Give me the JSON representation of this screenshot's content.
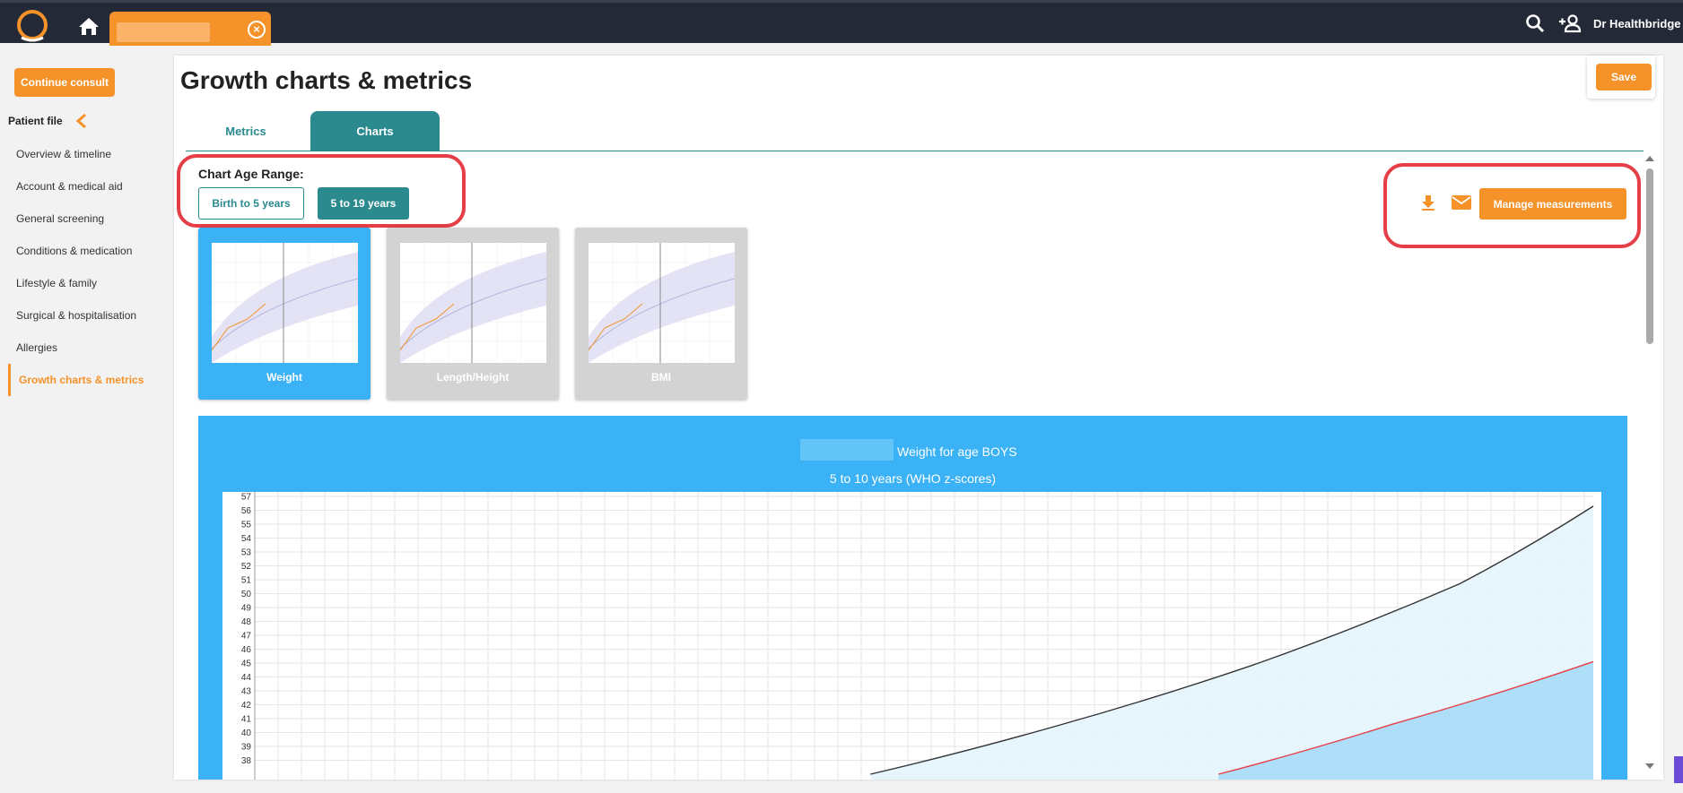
{
  "topbar": {
    "logo_icon": "ring-logo-icon",
    "home_icon": "home-icon",
    "patient_tab_close_icon": "close-circle-icon",
    "search_icon": "search-icon",
    "add_user_icon": "add-person-icon",
    "user_name": "Dr Healthbridge"
  },
  "sidebar": {
    "continue_label": "Continue consult",
    "patient_file_label": "Patient file",
    "collapse_icon": "chevron-left-icon",
    "items": [
      {
        "label": "Overview & timeline"
      },
      {
        "label": "Account & medical aid"
      },
      {
        "label": "General screening"
      },
      {
        "label": "Conditions & medication"
      },
      {
        "label": "Lifestyle & family"
      },
      {
        "label": "Surgical & hospitalisation"
      },
      {
        "label": "Allergies"
      },
      {
        "label": "Growth charts & metrics",
        "active": true
      }
    ]
  },
  "main": {
    "title": "Growth charts & metrics",
    "save_label": "Save",
    "tabs": [
      {
        "label": "Metrics",
        "active": false
      },
      {
        "label": "Charts",
        "active": true
      }
    ],
    "age_range_label": "Chart Age Range:",
    "age_ranges": [
      {
        "label": "Birth to 5 years",
        "selected": false
      },
      {
        "label": "5 to 19 years",
        "selected": true
      }
    ],
    "download_icon": "download-icon",
    "email_icon": "mail-icon",
    "manage_label": "Manage measurements",
    "chart_thumbnails": [
      {
        "label": "Weight",
        "selected": true
      },
      {
        "label": "Length/Height",
        "selected": false
      },
      {
        "label": "BMI",
        "selected": false
      }
    ],
    "chart_title": "Weight for age BOYS",
    "chart_subtitle": "5 to 10 years (WHO z-scores)"
  },
  "colors": {
    "accent_orange": "#f5922a",
    "teal": "#2b8a8e",
    "chart_blue": "#3bb2f5",
    "highlight_red": "#e53e46",
    "topbar": "#232936"
  },
  "chart_data": {
    "type": "line",
    "title": "Weight for age BOYS",
    "subtitle": "5 to 10 years (WHO z-scores)",
    "y_ticks": [
      38,
      39,
      40,
      41,
      42,
      43,
      44,
      45,
      46,
      47,
      48,
      49,
      50,
      51,
      52,
      53,
      54,
      55,
      56,
      57
    ],
    "ylim": [
      37,
      57
    ],
    "series": [
      {
        "color": "#333333",
        "x": [
          0.46,
          0.6,
          0.75,
          0.9,
          1.0
        ],
        "values": [
          37,
          40.5,
          45,
          50.7,
          56.3
        ]
      },
      {
        "color": "#e53e46",
        "x": [
          0.72,
          0.85,
          1.0
        ],
        "values": [
          37,
          40.6,
          45.1
        ]
      }
    ]
  }
}
